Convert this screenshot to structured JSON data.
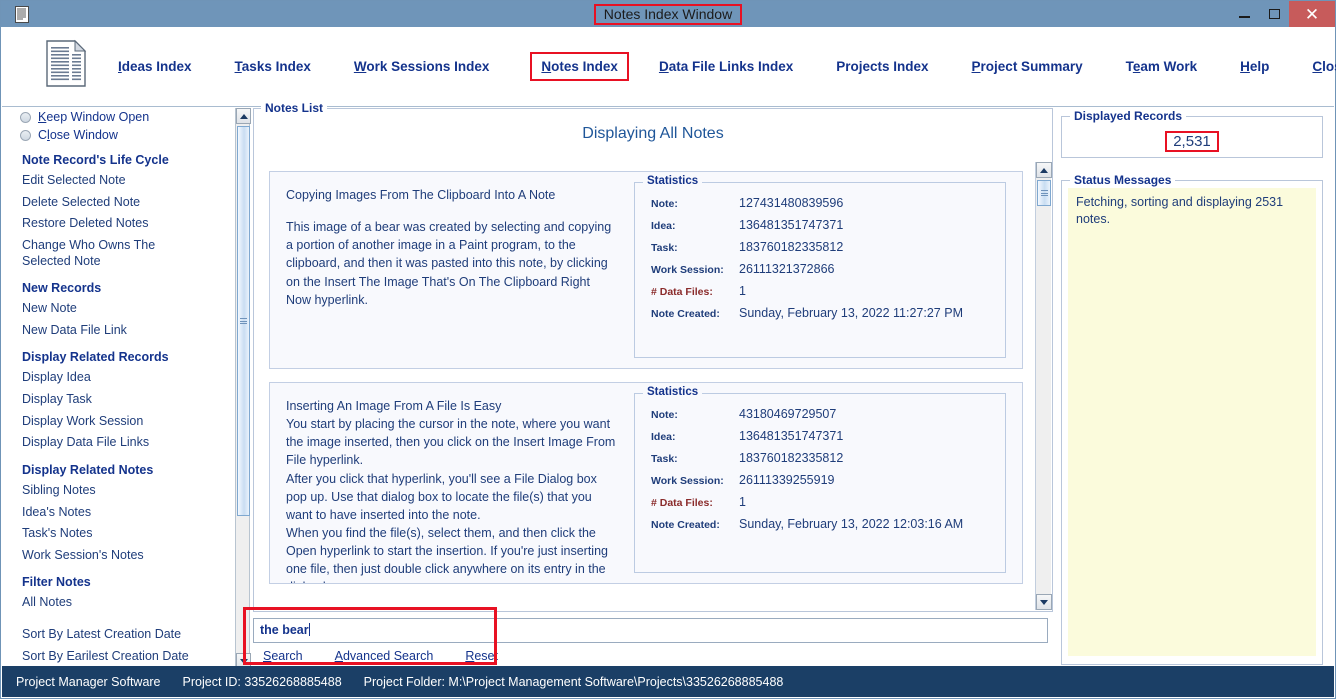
{
  "window": {
    "title": "Notes Index Window",
    "icon": "document-list-icon",
    "minimize_label": "Minimize",
    "maximize_label": "Maximize",
    "close_label": "Close",
    "accent_red": "#e81123",
    "titlebar_color": "#6f95b9"
  },
  "toolbar": {
    "icon": "document-icon",
    "items": [
      {
        "label": "Ideas Index",
        "accel": "I",
        "highlighted": false
      },
      {
        "label": "Tasks Index",
        "accel": "T",
        "highlighted": false
      },
      {
        "label": "Work Sessions Index",
        "accel": "W",
        "highlighted": false
      },
      {
        "label": "Notes Index",
        "accel": "N",
        "highlighted": true
      },
      {
        "label": "Data File Links Index",
        "accel": "D",
        "highlighted": false
      },
      {
        "label": "Projects Index",
        "accel": "",
        "highlighted": false
      },
      {
        "label": "Project Summary",
        "accel": "P",
        "highlighted": false
      },
      {
        "label": "Team Work",
        "accel": "e",
        "highlighted": false
      },
      {
        "label": "Help",
        "accel": "H",
        "highlighted": false
      },
      {
        "label": "Close Program",
        "accel": "C",
        "highlighted": false
      }
    ]
  },
  "sidebar": {
    "radios": [
      {
        "label": "Keep Window Open",
        "selected": false
      },
      {
        "label": "Close Window",
        "selected": false
      }
    ],
    "groups": [
      {
        "title": "Note Record's Life Cycle",
        "links": [
          "Edit Selected Note",
          "Delete Selected Note",
          "Restore Deleted Notes",
          "Change Who Owns The Selected Note"
        ]
      },
      {
        "title": "New Records",
        "links": [
          "New Note",
          "New Data File Link"
        ]
      },
      {
        "title": "Display Related Records",
        "links": [
          "Display Idea",
          "Display Task",
          "Display Work Session",
          "Display Data File Links"
        ]
      },
      {
        "title": "Display Related Notes",
        "links": [
          "Sibling Notes",
          "Idea's Notes",
          "Task's Notes",
          "Work Session's Notes"
        ]
      },
      {
        "title": "Filter Notes",
        "links": [
          "All Notes"
        ]
      }
    ],
    "sort_links": [
      "Sort By Latest Creation Date",
      "Sort By Earilest Creation Date"
    ]
  },
  "notes_panel": {
    "legend": "Notes List",
    "heading": "Displaying All Notes",
    "stat_labels": {
      "note": "Note:",
      "idea": "Idea:",
      "task": "Task:",
      "work_session": "Work Session:",
      "data_files": "# Data Files:",
      "note_created": "Note Created:"
    },
    "stats_legend": "Statistics",
    "notes": [
      {
        "heading": "Copying Images From The Clipboard Into A Note",
        "text": "This image of a bear was created by selecting and copying a portion of another image in a Paint program, to the clipboard, and then it was pasted into this note, by clicking on the Insert The Image That's On The Clipboard Right Now hyperlink.",
        "stats": {
          "note": "127431480839596",
          "idea": "136481351747371",
          "task": "183760182335812",
          "work_session": "26111321372866",
          "data_files": "1",
          "note_created": "Sunday, February 13, 2022   11:27:27 PM"
        }
      },
      {
        "heading": "Inserting An Image From A File Is Easy",
        "text": "You start by placing the cursor in the note, where you want the image inserted, then you click on the  Insert Image From File hyperlink.\nAfter you click that hyperlink, you'll see a File Dialog box pop up. Use that dialog box to locate the file(s) that you want to have inserted into the note.\nWhen you find the file(s), select them, and then click the Open hyperlink to start the insertion. If you're just inserting one file, then just double click anywhere on its entry in the dialog box.\nThe dialog box will close, and the image(s) in the selected",
        "stats": {
          "note": "43180469729507",
          "idea": "136481351747371",
          "task": "183760182335812",
          "work_session": "26111339255919",
          "data_files": "1",
          "note_created": "Sunday, February 13, 2022   12:03:16 AM"
        }
      }
    ]
  },
  "search": {
    "value": "the bear",
    "links": [
      "Search",
      "Advanced Search",
      "Reset"
    ]
  },
  "right_panel": {
    "records_legend": "Displayed Records",
    "records_value": "2,531",
    "status_legend": "Status Messages",
    "status_message": "Fetching, sorting and displaying 2531 notes."
  },
  "statusbar": {
    "app_name": "Project Manager Software",
    "project_id_label": "Project ID:  33526268885488",
    "project_folder_label": "Project Folder: M:\\Project Management Software\\Projects\\33526268885488"
  }
}
